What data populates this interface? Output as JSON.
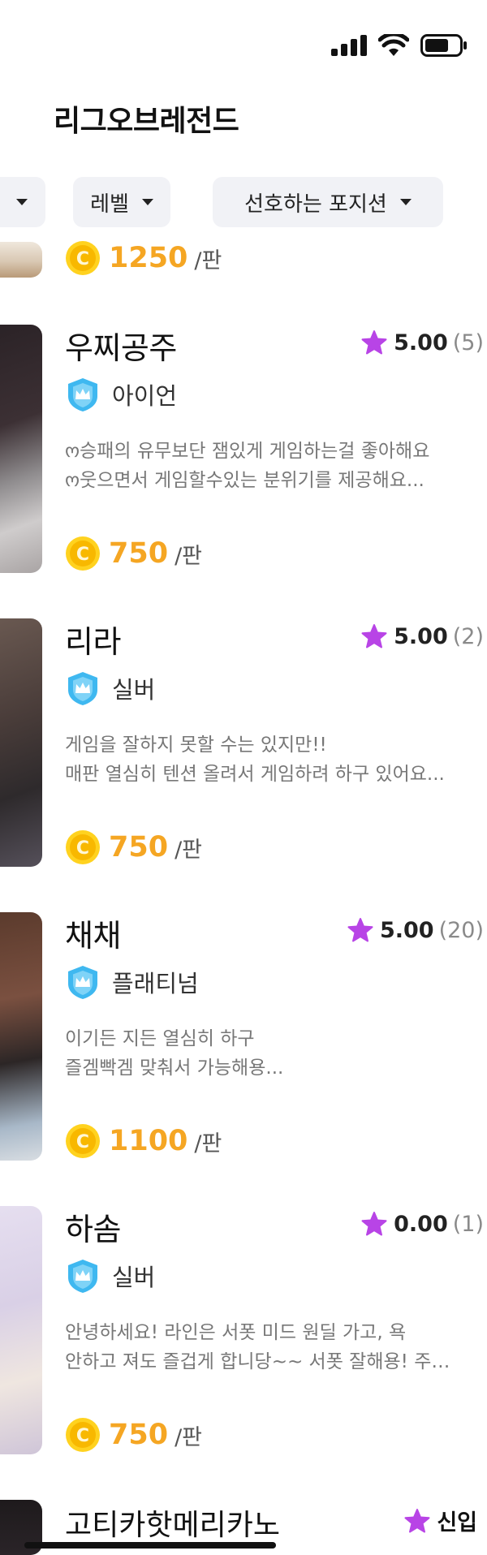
{
  "header": {
    "title": "리그오브레전드"
  },
  "filters": [
    {
      "label": "",
      "icon": "caret-down-icon"
    },
    {
      "label": "레벨",
      "icon": "caret-down-icon"
    },
    {
      "label": "선호하는 포지션",
      "icon": "caret-down-icon"
    }
  ],
  "colors": {
    "accent_coin": "#f5a623",
    "star": "#b844e6",
    "tier_badge": "#3fb8f0",
    "chip_bg": "#f1f2f6"
  },
  "top_partial_card": {
    "price": "1250",
    "unit": "/판"
  },
  "cards": [
    {
      "name": "우찌공주",
      "rating": "5.00",
      "count": "(5)",
      "tier": "아이언",
      "desc": [
        "ო승패의 유무보단 잼있게 게임하는걸 좋아해요",
        "ო웃으면서 게임할수있는 분위기를 제공해요..."
      ],
      "price": "750",
      "unit": "/판"
    },
    {
      "name": "리라",
      "rating": "5.00",
      "count": "(2)",
      "tier": "실버",
      "desc": [
        "게임을 잘하지 못할 수는 있지만!!",
        "매판 열심히 텐션 올려서 게임하려 하구 있어요..."
      ],
      "price": "750",
      "unit": "/판"
    },
    {
      "name": "채채",
      "rating": "5.00",
      "count": "(20)",
      "tier": "플래티넘",
      "desc": [
        "이기든 지든 열심히 하구",
        "즐겜빡겜 맞춰서 가능해용..."
      ],
      "price": "1100",
      "unit": "/판"
    },
    {
      "name": "하솜",
      "rating": "0.00",
      "count": "(1)",
      "tier": "실버",
      "desc": [
        "안녕하세요! 라인은 서폿 미드 원딜 가고, 욕",
        "안하고 져도 즐겁게 합니당~~ 서폿 잘해용! 주…"
      ],
      "price": "750",
      "unit": "/판"
    }
  ],
  "bottom_card": {
    "name": "고티카핫메리카노",
    "badge": "신입"
  }
}
